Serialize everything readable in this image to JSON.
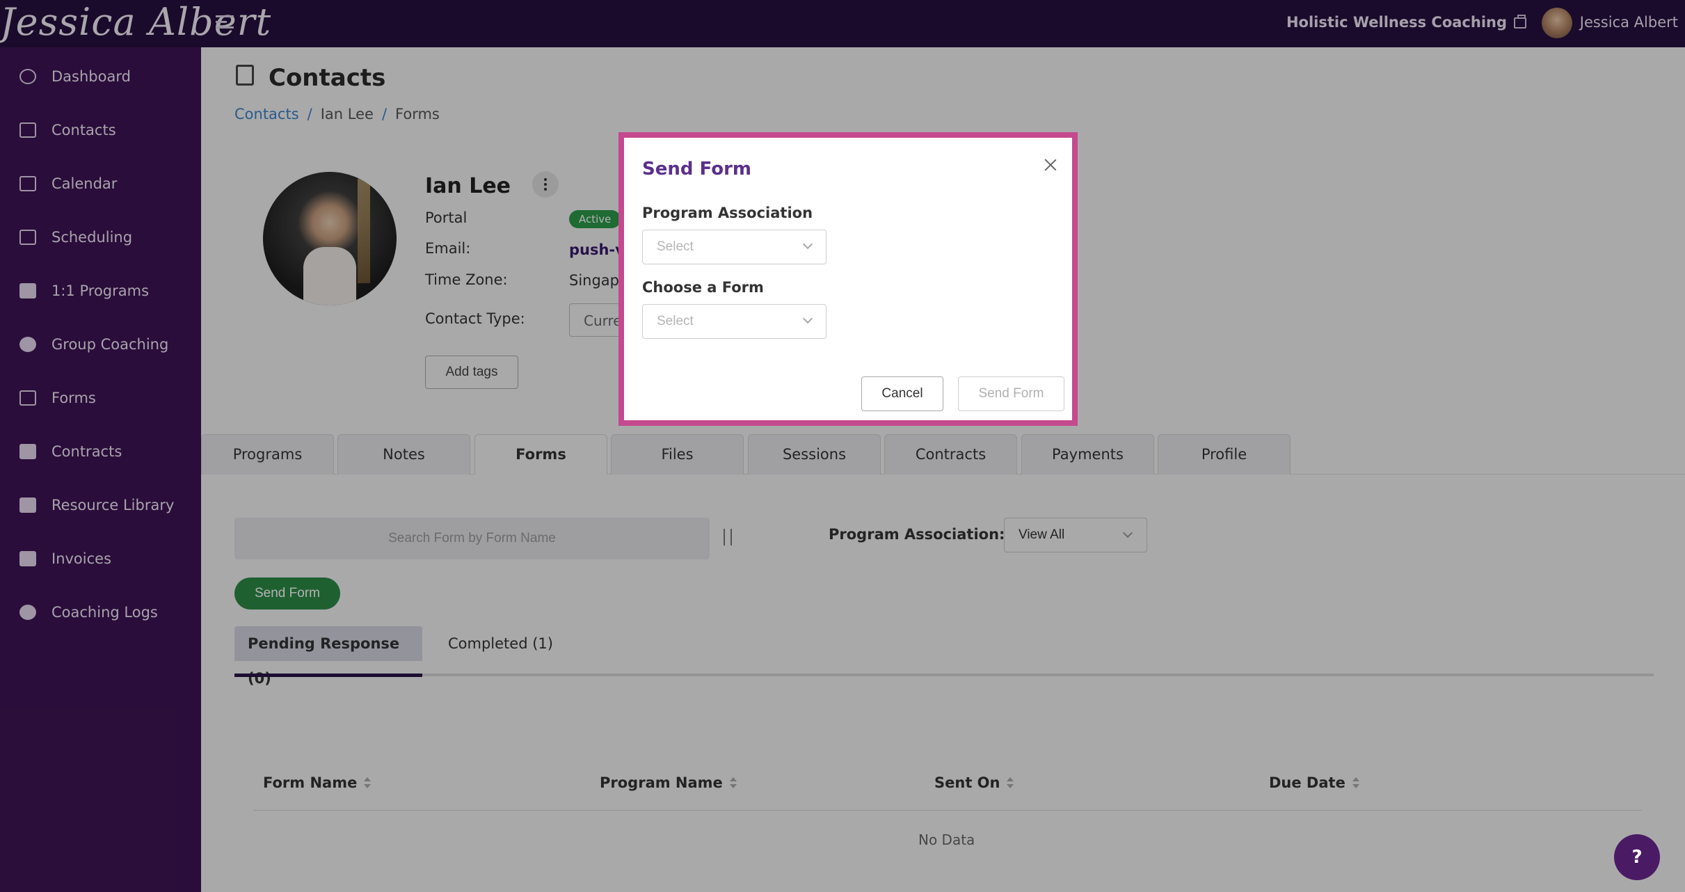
{
  "header": {
    "logo_text": "Jessica Albert",
    "org_name": "Holistic Wellness Coaching",
    "user_name": "Jessica Albert"
  },
  "sidebar": {
    "items": [
      {
        "label": "Dashboard",
        "icon": "dashboard-icon"
      },
      {
        "label": "Contacts",
        "icon": "contacts-icon"
      },
      {
        "label": "Calendar",
        "icon": "calendar-icon"
      },
      {
        "label": "Scheduling",
        "icon": "scheduling-icon"
      },
      {
        "label": "1:1 Programs",
        "icon": "book-icon"
      },
      {
        "label": "Group Coaching",
        "icon": "group-icon"
      },
      {
        "label": "Forms",
        "icon": "list-icon"
      },
      {
        "label": "Contracts",
        "icon": "signature-icon"
      },
      {
        "label": "Resource Library",
        "icon": "library-icon"
      },
      {
        "label": "Invoices",
        "icon": "invoice-icon"
      },
      {
        "label": "Coaching Logs",
        "icon": "clock-icon"
      }
    ]
  },
  "page": {
    "title": "Contacts",
    "breadcrumb": [
      "Contacts",
      "Ian Lee",
      "Forms"
    ]
  },
  "contact": {
    "name": "Ian Lee",
    "portal_label": "Portal",
    "portal_status": "Active",
    "email_label": "Email:",
    "email_value": "push-v",
    "timezone_label": "Time Zone:",
    "timezone_value": "Singap",
    "contact_type_label": "Contact Type:",
    "contact_type_value": "Curre",
    "add_tags": "Add tags"
  },
  "tabs": [
    "Programs",
    "Notes",
    "Forms",
    "Files",
    "Sessions",
    "Contracts",
    "Payments",
    "Profile"
  ],
  "active_tab": "Forms",
  "forms_panel": {
    "search_placeholder": "Search Form by Form Name",
    "program_association_label": "Program Association:",
    "program_association_value": "View All",
    "send_form_button": "Send Form",
    "sub_tabs": [
      "Pending Response (0)",
      "Completed (1)"
    ],
    "columns": [
      "Form Name",
      "Program Name",
      "Sent On",
      "Due Date"
    ],
    "empty_text": "No Data"
  },
  "help_button": "?",
  "modal": {
    "title": "Send Form",
    "program_label": "Program Association",
    "program_placeholder": "Select",
    "form_label": "Choose a Form",
    "form_placeholder": "Select",
    "cancel": "Cancel",
    "submit": "Send Form"
  },
  "colors": {
    "topbar": "#260f3e",
    "sidebar": "#3d1453",
    "modal_border": "#c4498e",
    "modal_title": "#5b2f8c",
    "send_green": "#2d8a47",
    "badge_green": "#2b9a4a"
  }
}
